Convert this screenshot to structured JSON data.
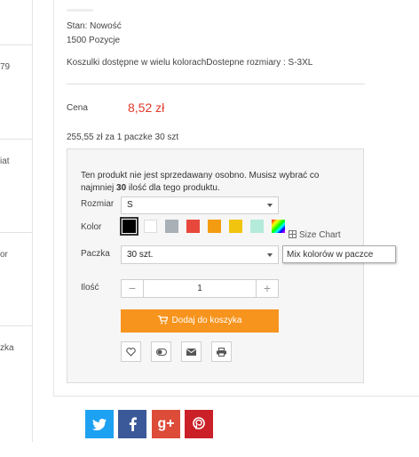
{
  "sidebar": {
    "fragments": [
      "79",
      "iat",
      "or",
      "zka"
    ]
  },
  "product": {
    "stock_line": "Stan: Nowość",
    "count_line": "1500 Pozycje",
    "description": "Koszulki dostępne w wielu kolorachDostepne rozmiary : S-3XL",
    "price_label": "Cena",
    "price_value": "8,52 zł",
    "pack_price": "255,55 zł za 1 paczke 30 szt"
  },
  "panel": {
    "notice_pre": "Ten produkt nie jest sprzedawany osobno. Musisz wybrać co najmniej ",
    "notice_min": "30",
    "notice_post": " ilość dla tego produktu.",
    "size_label": "Rozmiar",
    "size_value": "S",
    "color_label": "Kolor",
    "colors": [
      {
        "name": "black",
        "hex": "#000000",
        "selected": true
      },
      {
        "name": "white",
        "hex": "#ffffff",
        "selected": false
      },
      {
        "name": "grey",
        "hex": "#a9b0b6",
        "selected": false
      },
      {
        "name": "red",
        "hex": "#e8483c",
        "selected": false
      },
      {
        "name": "orange",
        "hex": "#f39c12",
        "selected": false
      },
      {
        "name": "yellow",
        "hex": "#f1c40f",
        "selected": false
      },
      {
        "name": "mint",
        "hex": "#b3ead9",
        "selected": false
      },
      {
        "name": "mix",
        "hex": "multicolor",
        "selected": false
      }
    ],
    "size_chart": "Size Chart",
    "tooltip": "Mix kolorów w paczce",
    "pack_label": "Paczka",
    "pack_value": "30 szt.",
    "qty_label": "Ilość",
    "qty_minus": "−",
    "qty_value": "1",
    "qty_plus": "+",
    "add_to_cart": "Dodaj do koszyka",
    "actions": [
      "heart-icon",
      "compare-icon",
      "envelope-icon",
      "print-icon"
    ]
  },
  "social": [
    {
      "name": "twitter",
      "color": "#1da1f2"
    },
    {
      "name": "facebook",
      "color": "#3b5998"
    },
    {
      "name": "googleplus",
      "color": "#dd4b39",
      "text": "g+"
    },
    {
      "name": "pinterest",
      "color": "#cb2027"
    }
  ]
}
